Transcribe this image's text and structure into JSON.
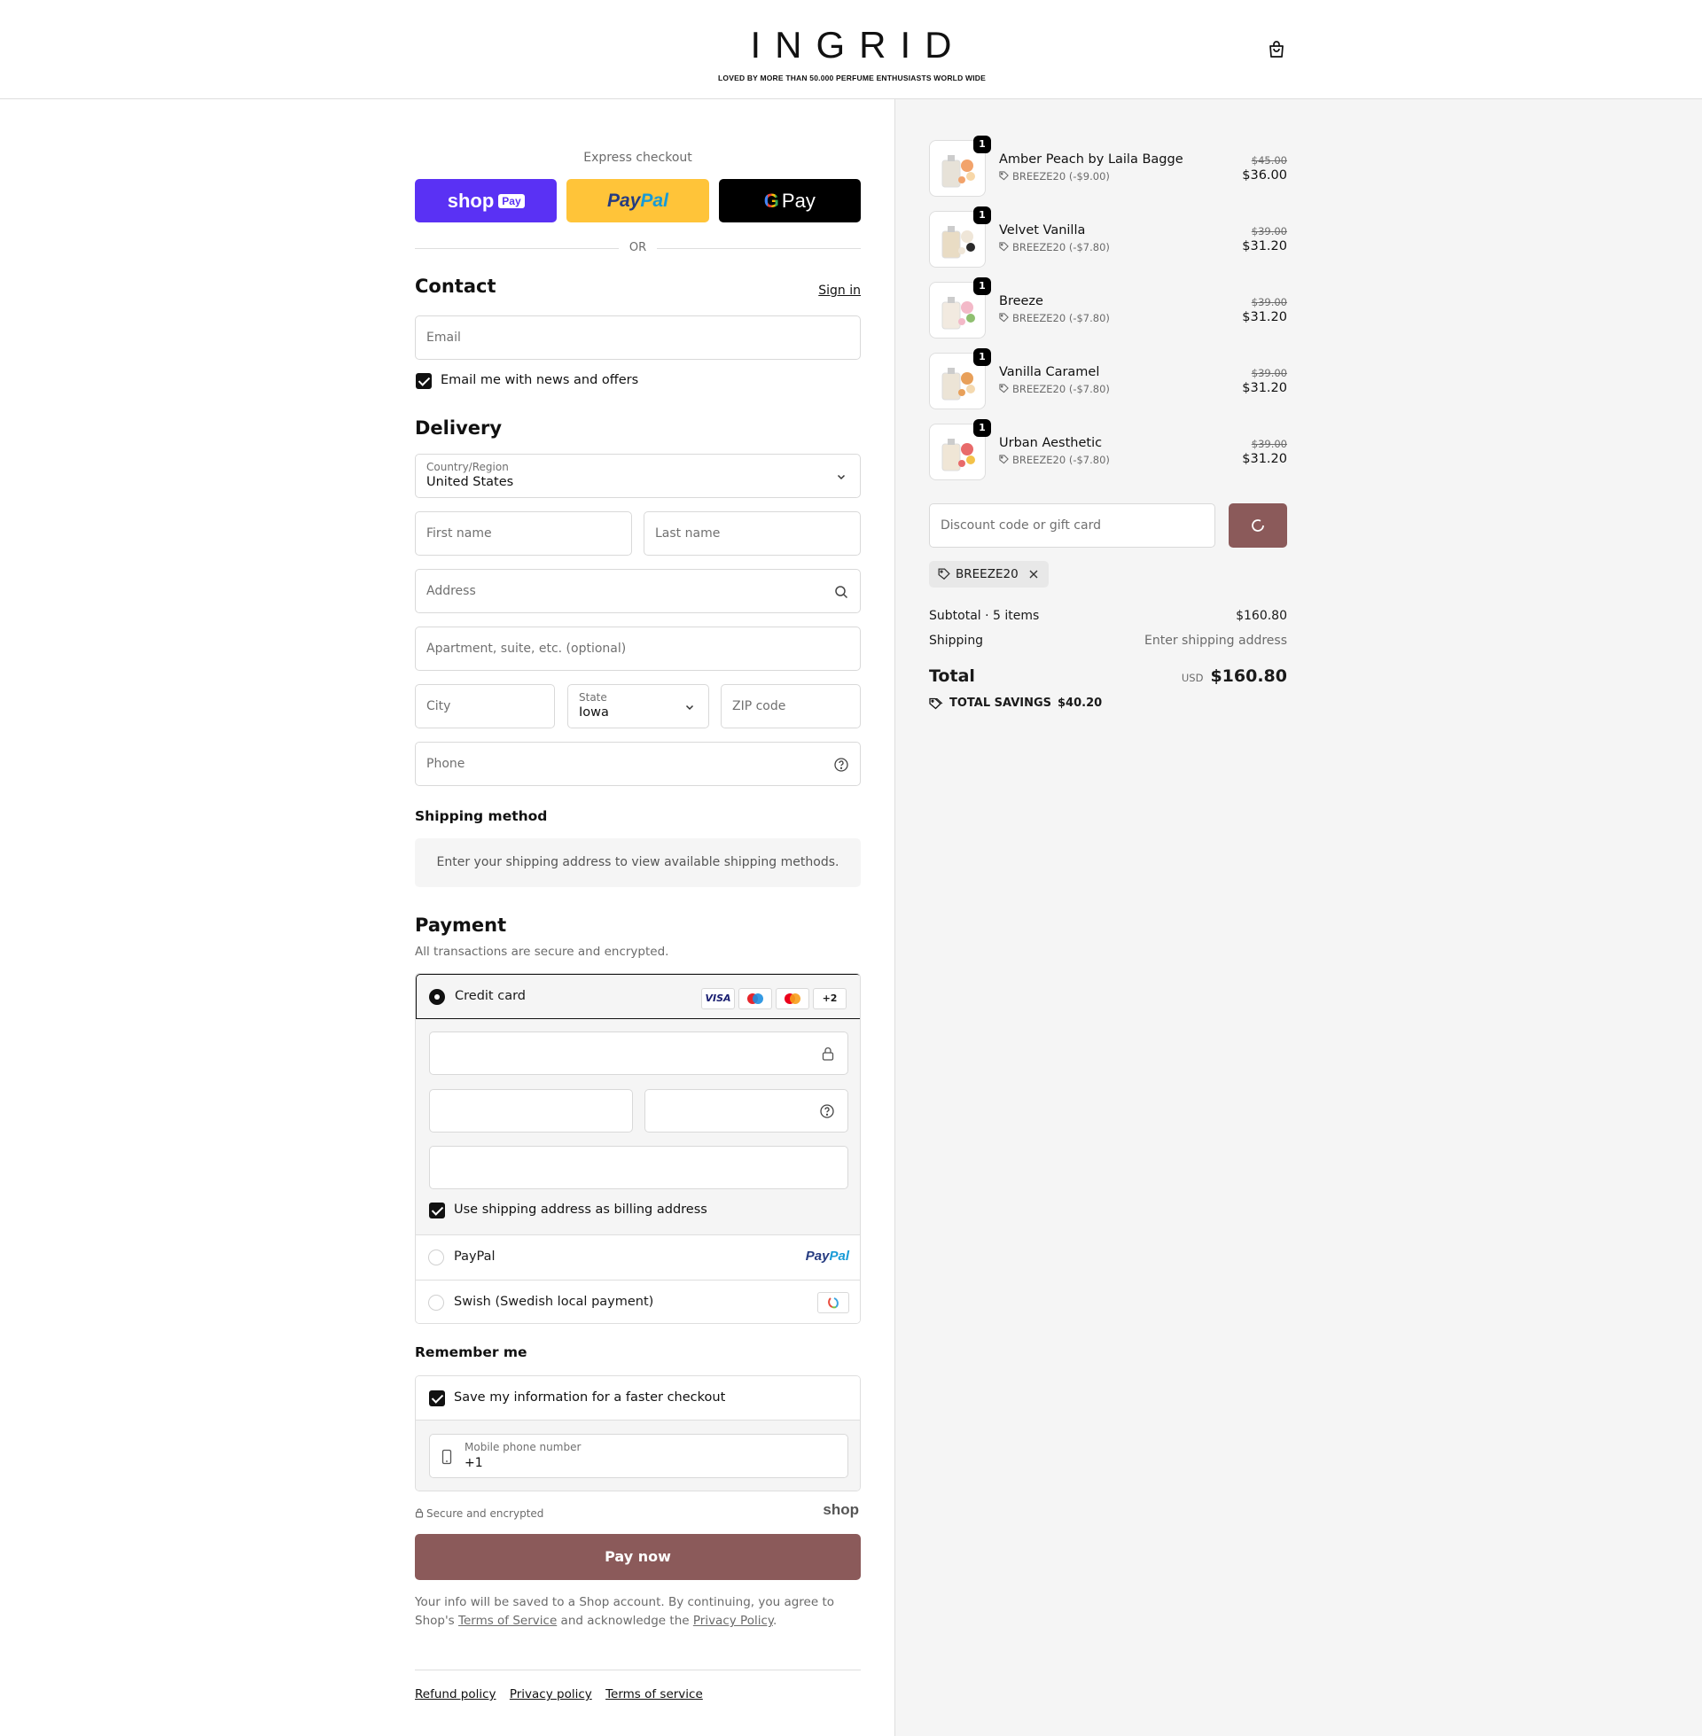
{
  "header": {
    "logo": "INGRID",
    "tagline": "LOVED BY MORE THAN 50.000 PERFUME ENTHUSIASTS WORLD WIDE"
  },
  "express": {
    "label": "Express checkout",
    "shop_pay": "shop",
    "shop_pay_badge": "Pay",
    "paypal_a": "Pay",
    "paypal_b": "Pal",
    "gpay_g": "G",
    "gpay_text": "Pay",
    "or": "OR"
  },
  "contact": {
    "title": "Contact",
    "sign_in": "Sign in",
    "email_placeholder": "Email",
    "newsletter": "Email me with news and offers"
  },
  "delivery": {
    "title": "Delivery",
    "country_label": "Country/Region",
    "country_value": "United States",
    "first_name": "First name",
    "last_name": "Last name",
    "address": "Address",
    "apartment": "Apartment, suite, etc. (optional)",
    "city": "City",
    "state_label": "State",
    "state_value": "Iowa",
    "zip": "ZIP code",
    "phone": "Phone"
  },
  "shipping": {
    "title": "Shipping method",
    "message": "Enter your shipping address to view available shipping methods."
  },
  "payment": {
    "title": "Payment",
    "subtitle": "All transactions are secure and encrypted.",
    "credit_card": "Credit card",
    "card_badges": [
      "VISA",
      "+2"
    ],
    "billing_same": "Use shipping address as billing address",
    "paypal": "PayPal",
    "paypal_logo_a": "Pay",
    "paypal_logo_b": "Pal",
    "swish": "Swish (Swedish local payment)"
  },
  "remember": {
    "title": "Remember me",
    "save_info": "Save my information for a faster checkout",
    "mobile_label": "Mobile phone number",
    "mobile_value": "+1",
    "secure": "Secure and encrypted",
    "shop_logo": "shop"
  },
  "pay_now": "Pay now",
  "legal": {
    "text1": "Your info will be saved to a Shop account. By continuing, you agree to Shop's",
    "terms": "Terms of Service",
    "text2": "and acknowledge the",
    "privacy": "Privacy Policy",
    "text3": "."
  },
  "footer": {
    "refund": "Refund policy",
    "privacy": "Privacy policy",
    "terms": "Terms of service"
  },
  "summary": {
    "items": [
      {
        "name": "Amber Peach by Laila Bagge",
        "qty": "1",
        "discount": "BREEZE20 (-$9.00)",
        "old_price": "$45.00",
        "price": "$36.00",
        "colors": [
          "#f2a36b",
          "#f7d7a8",
          "#e7e2d8"
        ]
      },
      {
        "name": "Velvet Vanilla",
        "qty": "1",
        "discount": "BREEZE20 (-$7.80)",
        "old_price": "$39.00",
        "price": "$31.20",
        "colors": [
          "#efe6d8",
          "#2b2b2b",
          "#e9dcc4"
        ]
      },
      {
        "name": "Breeze",
        "qty": "1",
        "discount": "BREEZE20 (-$7.80)",
        "old_price": "$39.00",
        "price": "$31.20",
        "colors": [
          "#f3b9c8",
          "#8fbf70",
          "#f2eae0"
        ]
      },
      {
        "name": "Vanilla Caramel",
        "qty": "1",
        "discount": "BREEZE20 (-$7.80)",
        "old_price": "$39.00",
        "price": "$31.20",
        "colors": [
          "#e8a05a",
          "#f4d9b0",
          "#ece4d6"
        ]
      },
      {
        "name": "Urban Aesthetic",
        "qty": "1",
        "discount": "BREEZE20 (-$7.80)",
        "old_price": "$39.00",
        "price": "$31.20",
        "colors": [
          "#e86a6a",
          "#f3c24a",
          "#f0e6d6"
        ]
      }
    ],
    "discount_placeholder": "Discount code or gift card",
    "applied_code": "BREEZE20",
    "subtotal_label": "Subtotal · 5 items",
    "subtotal_value": "$160.80",
    "shipping_label": "Shipping",
    "shipping_value": "Enter shipping address",
    "total_label": "Total",
    "currency": "USD",
    "total_value": "$160.80",
    "savings_label": "TOTAL SAVINGS",
    "savings_value": "$40.20"
  },
  "colors": {
    "accent": "#8b5a5a",
    "shop_purple": "#5a31f4",
    "paypal_yellow": "#ffc439"
  }
}
